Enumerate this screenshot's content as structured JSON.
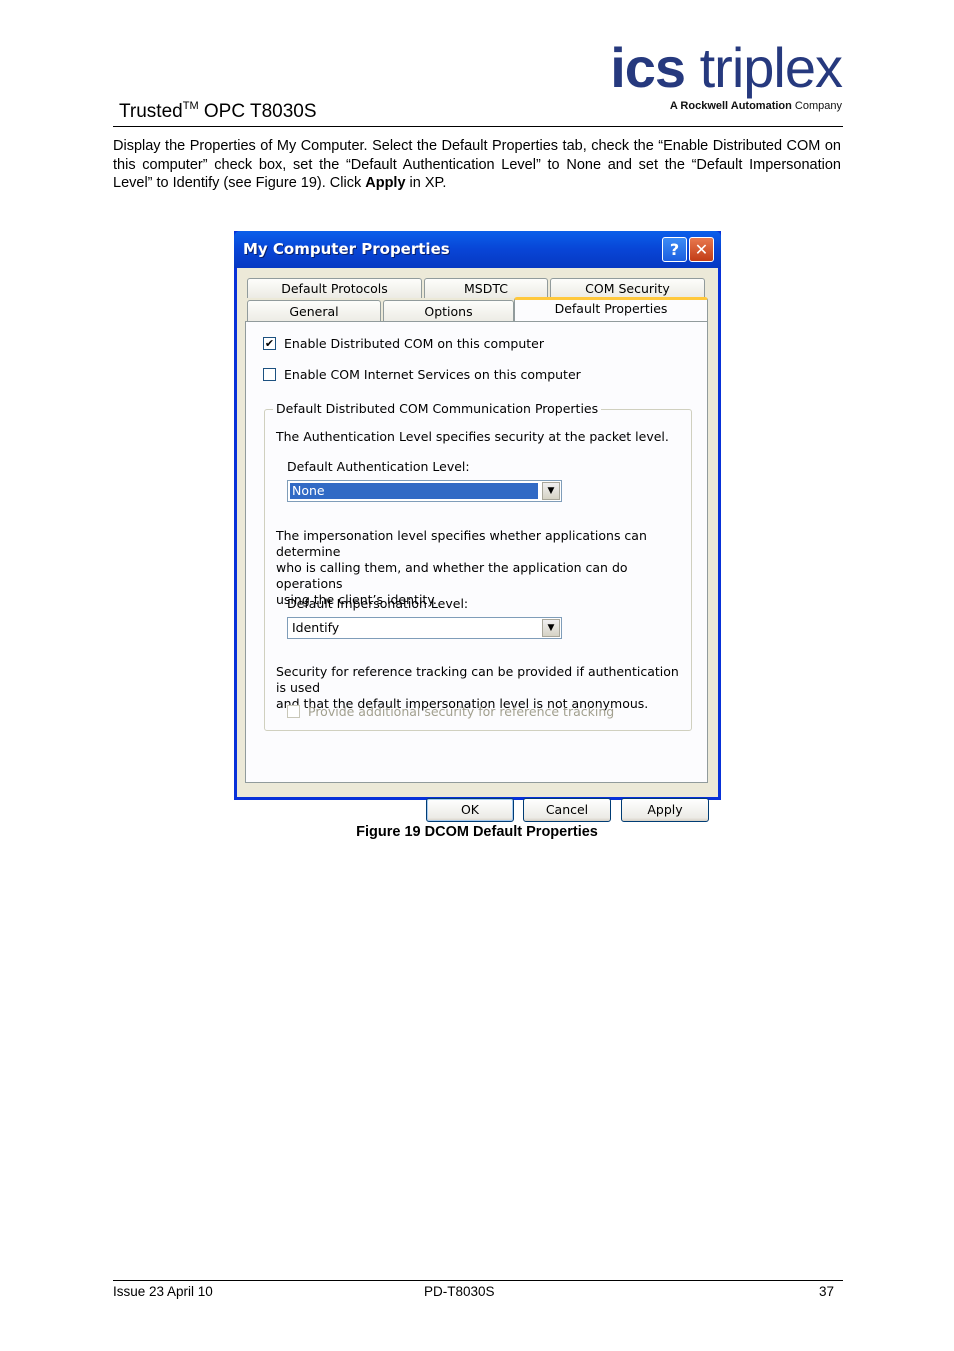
{
  "header": {
    "product": "Trusted",
    "tm": "TM",
    "rest": " OPC T8030S",
    "logo_bold": "ics",
    "logo_light": "triplex",
    "logo_tag": "A Rockwell Automation",
    "logo_company": "Company"
  },
  "body": {
    "text_1": "Display the Properties of My Computer.  Select the Default Properties tab, check the “Enable Distributed COM on this computer” check box, set the “Default Authentication Level” to None and set the “Default Impersonation Level” to Identify (see Figure 19).  Click ",
    "text_bold": "Apply",
    "text_2": " in XP."
  },
  "dialog": {
    "title": "My Computer Properties",
    "help": "?",
    "close": "✕",
    "tabs_row1": [
      "Default Protocols",
      "MSDTC",
      "COM Security"
    ],
    "tabs_row2": [
      "General",
      "Options",
      "Default Properties"
    ],
    "enable_dcom": "Enable Distributed COM on this computer",
    "enable_cis": "Enable COM Internet Services on this computer",
    "group_title": "Default Distributed COM Communication Properties",
    "auth_desc": "The Authentication Level specifies security at the packet level.",
    "auth_label": "Default Authentication Level:",
    "auth_value": "None",
    "imp_desc_1": "The impersonation level specifies whether applications can determine",
    "imp_desc_2": "who is calling them, and whether the application can do operations",
    "imp_desc_3": "using the client’s identity.",
    "imp_label": "Default Impersonation Level:",
    "imp_value": "Identify",
    "ref_desc_1": "Security for reference tracking can be provided if authentication is used",
    "ref_desc_2": "and that the default impersonation level is not anonymous.",
    "ref_checkbox": "Provide additional security for reference tracking",
    "ok": "OK",
    "cancel": "Cancel",
    "apply": "Apply",
    "check_mark": "✔",
    "arrow": "▼"
  },
  "caption": "Figure 19 DCOM Default Properties",
  "footer": {
    "left": "Issue 23 April 10",
    "center": "PD-T8030S",
    "right": "37"
  }
}
